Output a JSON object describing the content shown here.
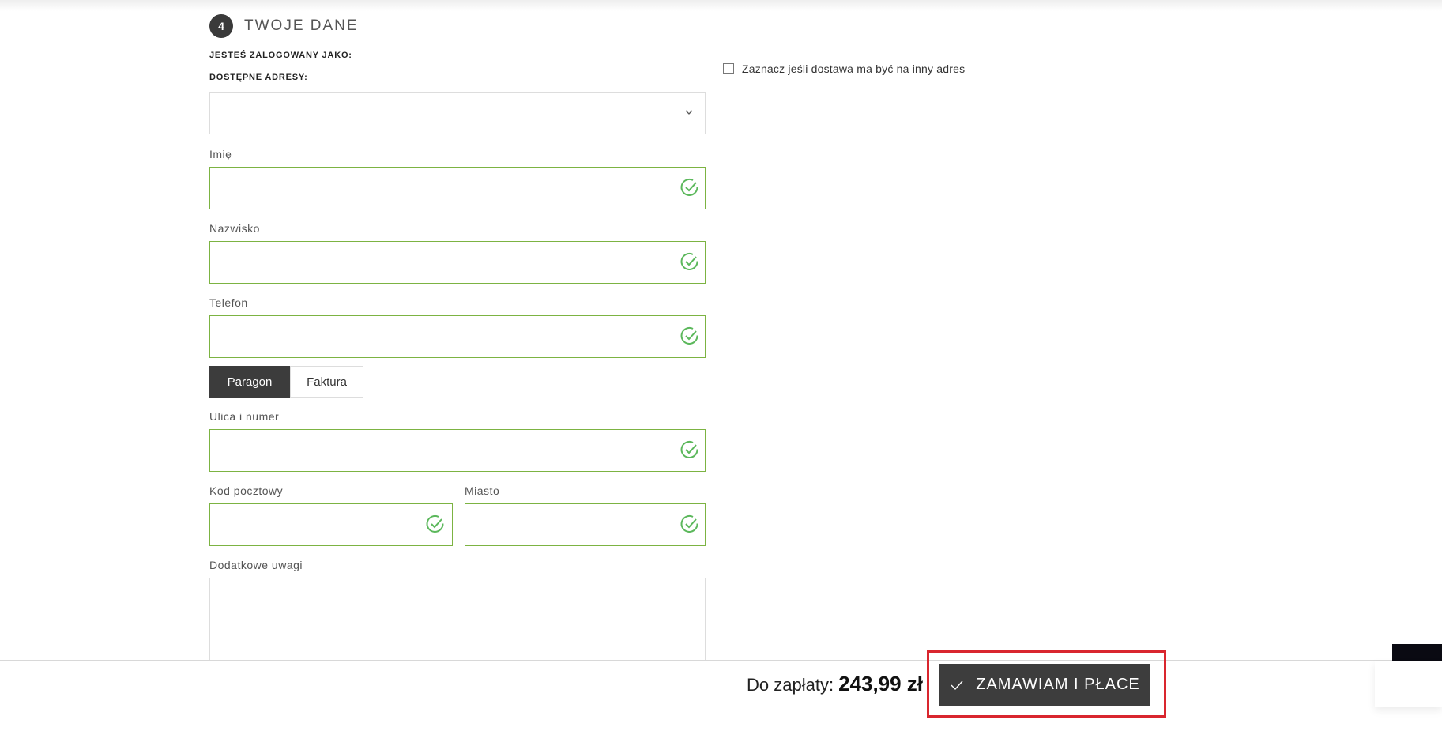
{
  "section": {
    "step": "4",
    "title": "TWOJE DANE"
  },
  "account": {
    "logged_in_label": "JESTEŚ ZALOGOWANY JAKO:",
    "addresses_label": "DOSTĘPNE ADRESY:"
  },
  "address_select": {
    "value": ""
  },
  "fields": {
    "first_name": {
      "label": "Imię",
      "value": ""
    },
    "last_name": {
      "label": "Nazwisko",
      "value": ""
    },
    "phone": {
      "label": "Telefon",
      "value": ""
    },
    "street": {
      "label": "Ulica i numer",
      "value": ""
    },
    "postal_code": {
      "label": "Kod pocztowy",
      "value": ""
    },
    "city": {
      "label": "Miasto",
      "value": ""
    },
    "notes": {
      "label": "Dodatkowe uwagi",
      "value": ""
    }
  },
  "document_type": {
    "options": [
      "Paragon",
      "Faktura"
    ],
    "selected": "Paragon"
  },
  "alt_delivery": {
    "label": "Zaznacz jeśli dostawa ma być na inny adres",
    "checked": false
  },
  "summary": {
    "label": "Do zapłaty:",
    "amount": "243,99 zł"
  },
  "order_button": {
    "label": "ZAMAWIAM I PŁACE"
  },
  "colors": {
    "valid_border": "#7cb342",
    "valid_check": "#5cb85c",
    "dark_button": "#3d3d3d",
    "highlight": "#d9262e"
  },
  "icons": {
    "valid": "check-circle-icon",
    "dropdown": "chevron-down-icon",
    "order": "check-icon"
  }
}
